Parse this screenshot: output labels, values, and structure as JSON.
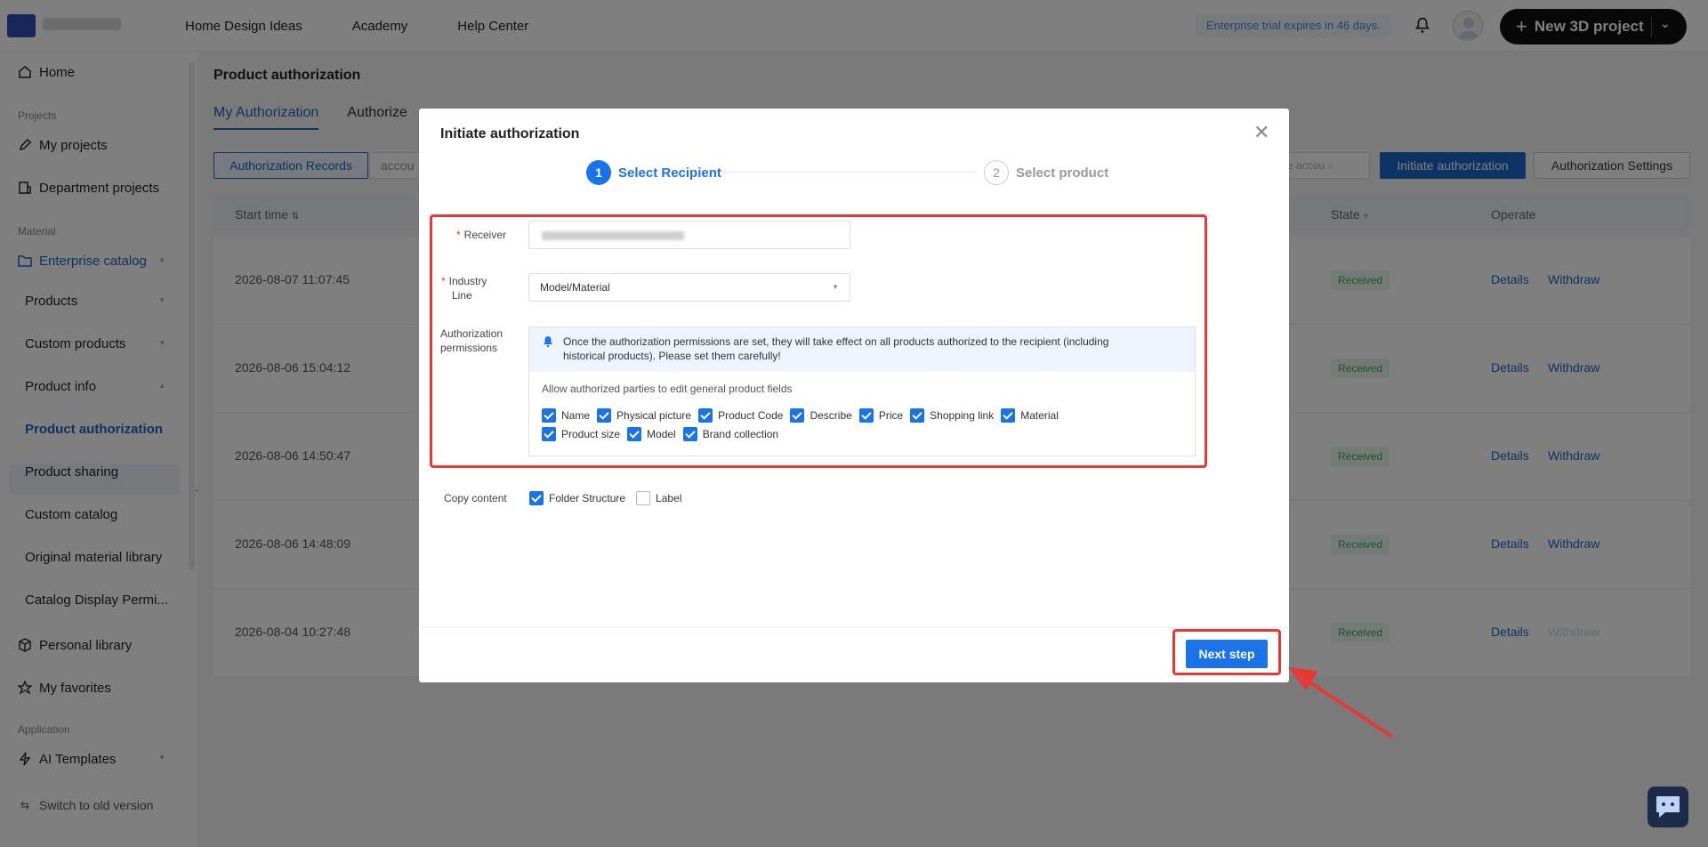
{
  "topbar": {
    "nav": [
      "Home Design Ideas",
      "Academy",
      "Help Center"
    ],
    "trial_text": "Enterprise trial expires in 46 days.",
    "new_project_label": "New 3D project"
  },
  "sidebar": {
    "home": "Home",
    "section_projects": "Projects",
    "my_projects": "My projects",
    "department_projects": "Department projects",
    "section_material": "Material",
    "enterprise_catalog": "Enterprise catalog",
    "products": "Products",
    "custom_products": "Custom products",
    "product_info": "Product info",
    "product_authorization": "Product authorization",
    "product_sharing": "Product sharing",
    "custom_catalog": "Custom catalog",
    "original_material_library": "Original material library",
    "catalog_display": "Catalog Display Permi...",
    "personal_library": "Personal library",
    "my_favorites": "My favorites",
    "section_application": "Application",
    "ai_templates": "AI Templates",
    "switch_old": "Switch to old version"
  },
  "page": {
    "title": "Product authorization",
    "tabs": [
      "My Authorization",
      "Authorize"
    ],
    "records_btn": "Authorization Records",
    "account_placeholder": "accou",
    "search_placeholder": "ate accou",
    "initiate_btn": "Initiate authorization",
    "settings_btn": "Authorization Settings",
    "columns": {
      "start_time": "Start time",
      "state": "State",
      "operate": "Operate"
    },
    "rows": [
      {
        "time": "2026-08-07 11:07:45",
        "state": "Received",
        "op1": "Details",
        "op2": "Withdraw"
      },
      {
        "time": "2026-08-06 15:04:12",
        "state": "Received",
        "op1": "Details",
        "op2": "Withdraw"
      },
      {
        "time": "2026-08-06 14:50:47",
        "state": "Received",
        "op1": "Details",
        "op2": "Withdraw"
      },
      {
        "time": "2026-08-06 14:48:09",
        "state": "Received",
        "op1": "Details",
        "op2": "Withdraw"
      },
      {
        "time": "2026-08-04 10:27:48",
        "state": "Received",
        "op1": "Details",
        "op2": "Withdraw"
      }
    ]
  },
  "modal": {
    "title": "Initiate authorization",
    "step1": {
      "num": "1",
      "label": "Select Recipient"
    },
    "step2": {
      "num": "2",
      "label": "Select product"
    },
    "receiver_label": "Receiver",
    "industry_label_1": "Industry",
    "industry_label_2": "Line",
    "industry_value": "Model/Material",
    "perm_label_1": "Authorization",
    "perm_label_2": "permissions",
    "notice_line1": "Once the authorization permissions are set, they will take effect on all products authorized to the recipient (including",
    "notice_line2": "historical products). Please set them carefully!",
    "allow_text": "Allow authorized parties to edit general product fields",
    "fields_row1": [
      "Name",
      "Physical picture",
      "Product Code",
      "Describe",
      "Price",
      "Shopping link",
      "Material"
    ],
    "fields_row2": [
      "Product size",
      "Model",
      "Brand collection"
    ],
    "copy_label": "Copy content",
    "copy_options": [
      "Folder Structure",
      "Label"
    ],
    "next_btn": "Next step"
  }
}
